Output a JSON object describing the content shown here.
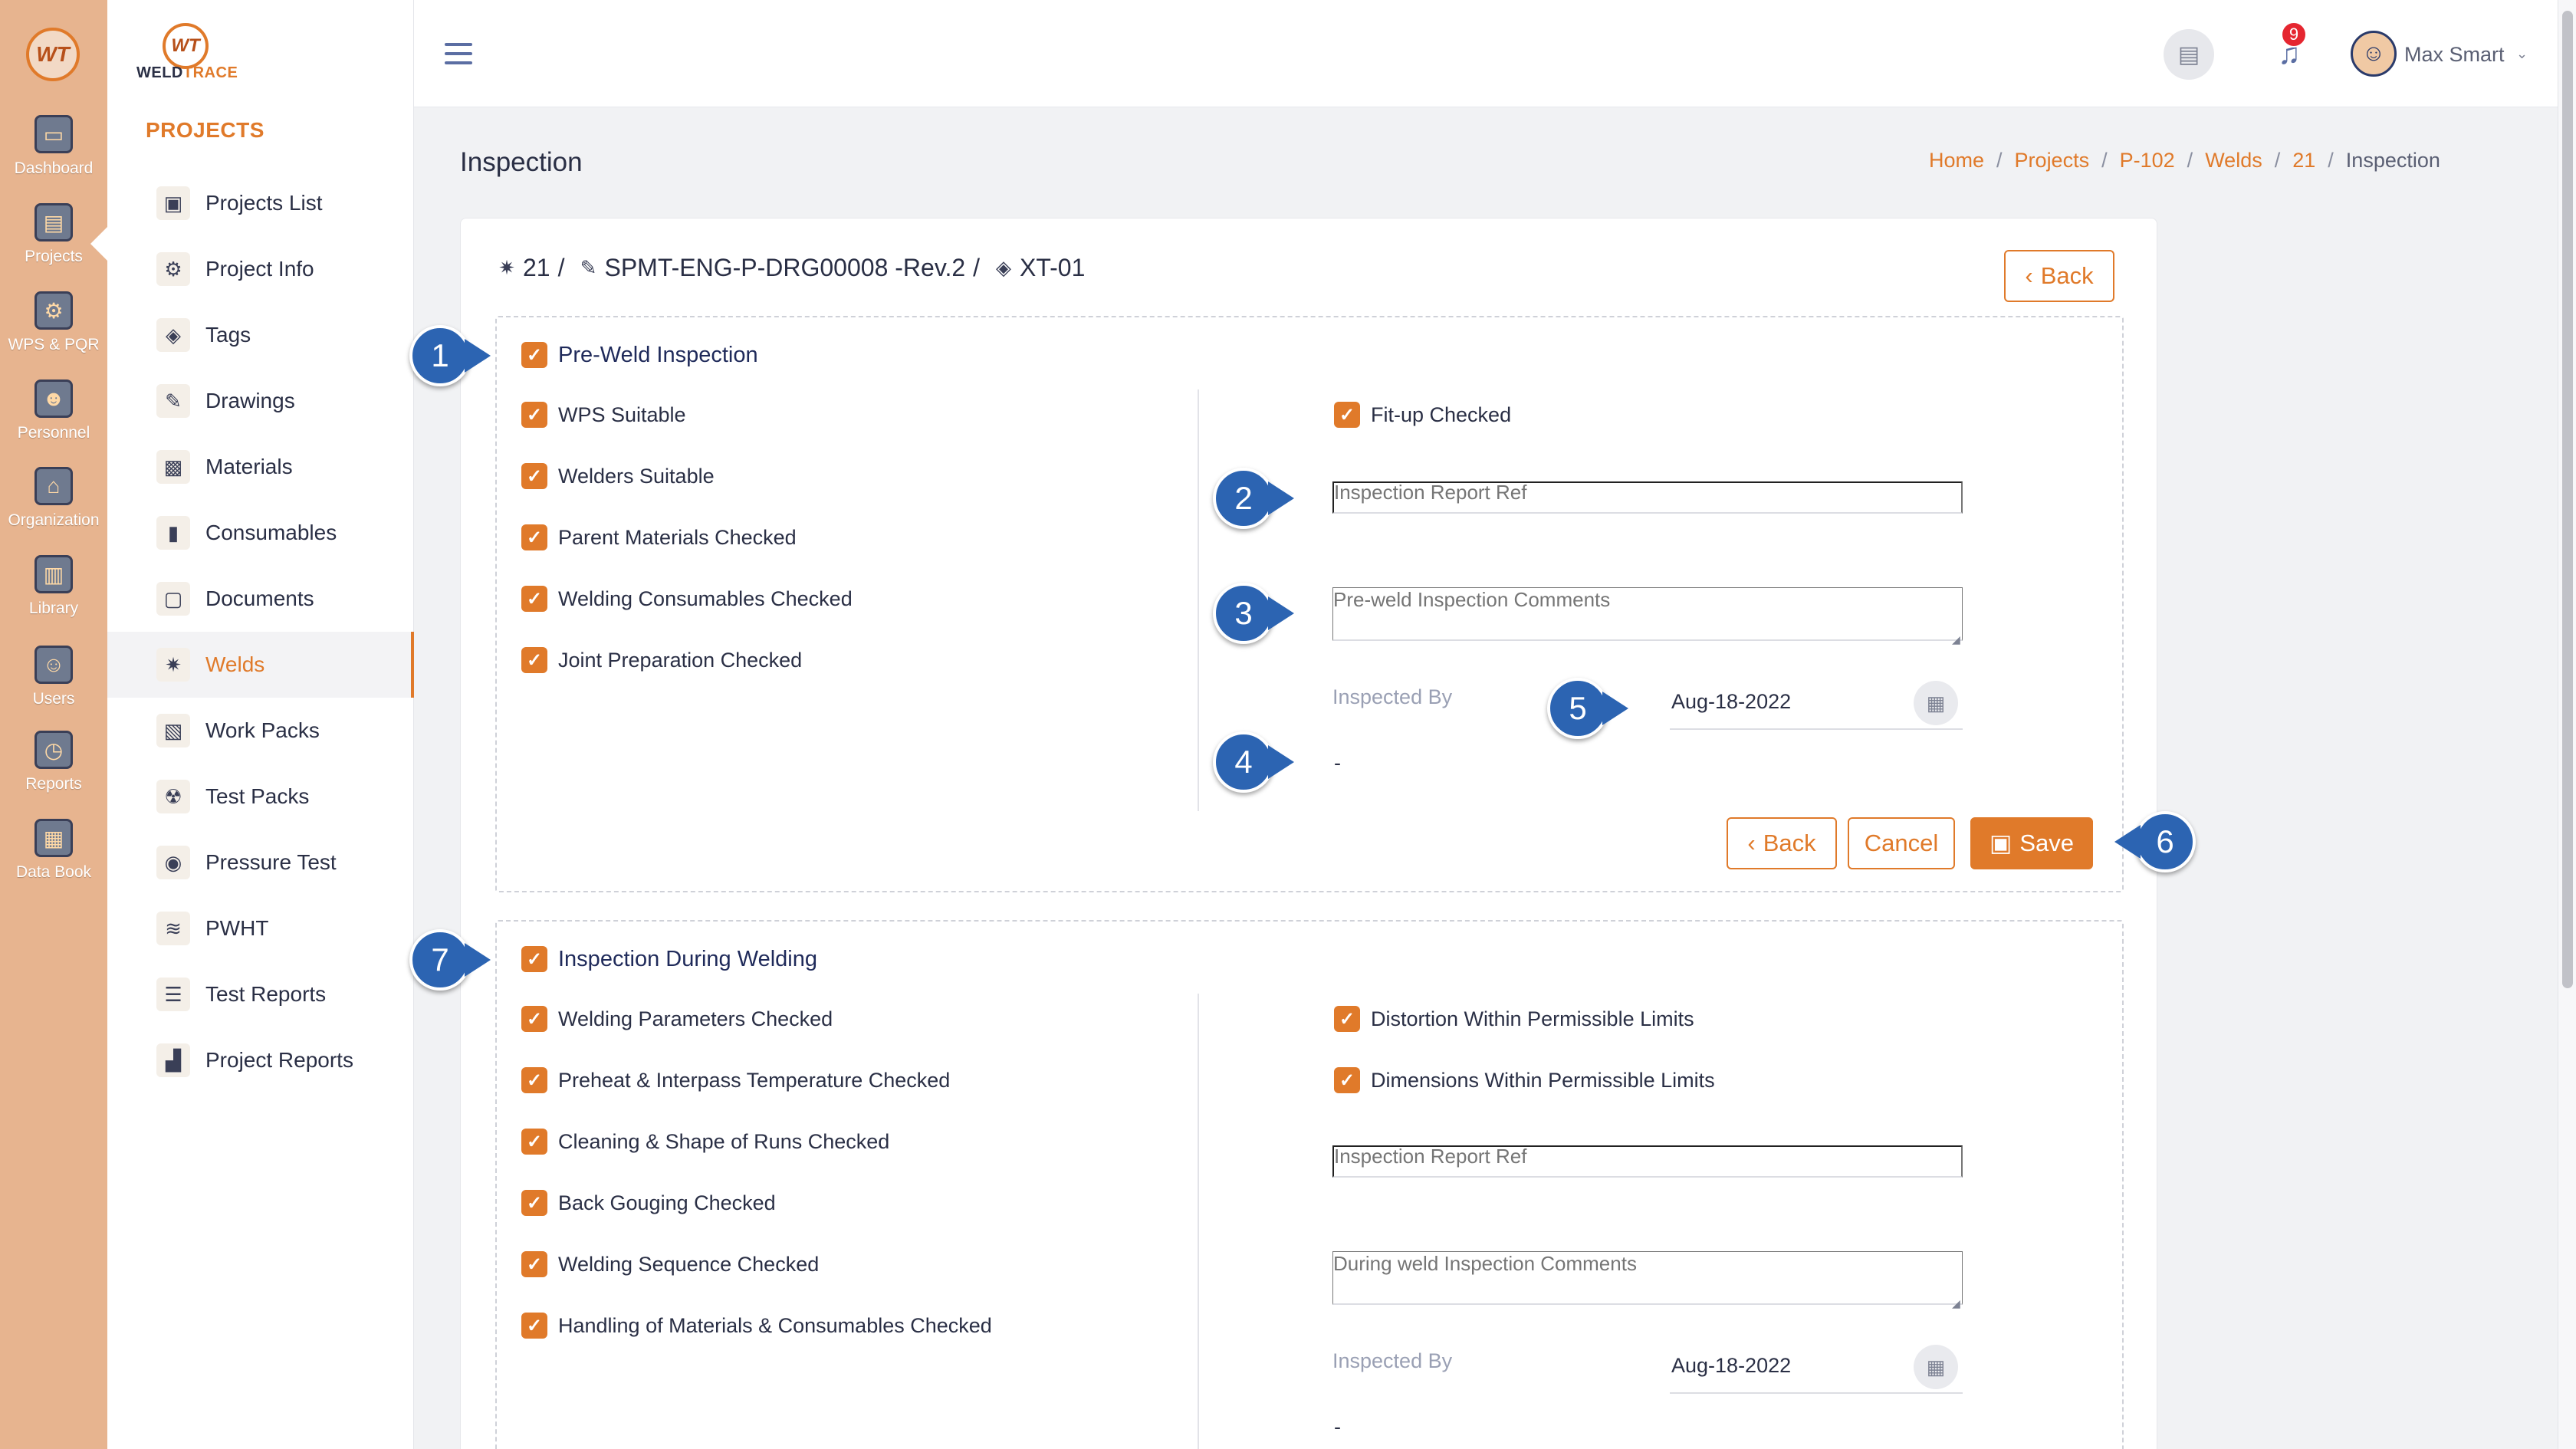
{
  "rail": {
    "logo": "WT",
    "items": [
      {
        "label": "Dashboard",
        "icon": "monitor-icon"
      },
      {
        "label": "Projects",
        "icon": "folder-gear-icon"
      },
      {
        "label": "WPS & PQR",
        "icon": "document-gear-icon"
      },
      {
        "label": "Personnel",
        "icon": "welder-icon"
      },
      {
        "label": "Organization",
        "icon": "organization-icon"
      },
      {
        "label": "Library",
        "icon": "book-icon"
      },
      {
        "label": "Users",
        "icon": "users-icon"
      },
      {
        "label": "Reports",
        "icon": "report-clock-icon"
      },
      {
        "label": "Data Book",
        "icon": "data-book-icon"
      }
    ]
  },
  "brand": {
    "mark": "WT",
    "name_prefix": "WELD",
    "name_suffix": "TRACE"
  },
  "sidebar": {
    "section_title": "PROJECTS",
    "items": [
      {
        "label": "Projects List",
        "icon": "projects-list-icon"
      },
      {
        "label": "Project Info",
        "icon": "project-info-icon"
      },
      {
        "label": "Tags",
        "icon": "tag-icon"
      },
      {
        "label": "Drawings",
        "icon": "drawing-icon"
      },
      {
        "label": "Materials",
        "icon": "materials-icon"
      },
      {
        "label": "Consumables",
        "icon": "consumables-icon"
      },
      {
        "label": "Documents",
        "icon": "documents-icon"
      },
      {
        "label": "Welds",
        "icon": "weld-spark-icon",
        "active": true
      },
      {
        "label": "Work Packs",
        "icon": "work-pack-icon"
      },
      {
        "label": "Test Packs",
        "icon": "radiation-icon"
      },
      {
        "label": "Pressure Test",
        "icon": "pressure-gauge-icon"
      },
      {
        "label": "PWHT",
        "icon": "heat-treatment-icon"
      },
      {
        "label": "Test Reports",
        "icon": "checklist-icon"
      },
      {
        "label": "Project Reports",
        "icon": "chart-report-icon"
      }
    ]
  },
  "header": {
    "notification_count": "9",
    "user_name": "Max Smart"
  },
  "page": {
    "title": "Inspection",
    "breadcrumb": [
      "Home",
      "Projects",
      "P-102",
      "Welds",
      "21",
      "Inspection"
    ]
  },
  "record": {
    "weld": "21",
    "drawing": "SPMT-ENG-P-DRG00008 -Rev.2",
    "tag": "XT-01"
  },
  "buttons": {
    "back": "Back",
    "cancel": "Cancel",
    "save": "Save"
  },
  "pre_weld": {
    "heading": "Pre-Weld Inspection",
    "left_checks": [
      "WPS Suitable",
      "Welders Suitable",
      "Parent Materials Checked",
      "Welding Consumables Checked",
      "Joint Preparation Checked"
    ],
    "right_checks": [
      "Fit-up Checked"
    ],
    "report_ref_placeholder": "Inspection Report Ref",
    "comments_placeholder": "Pre-weld Inspection Comments",
    "inspected_by_label": "Inspected By",
    "inspected_by_value": "-",
    "date": "Aug-18-2022"
  },
  "during_weld": {
    "heading": "Inspection During Welding",
    "left_checks": [
      "Welding Parameters Checked",
      "Preheat & Interpass Temperature Checked",
      "Cleaning & Shape of Runs Checked",
      "Back Gouging Checked",
      "Welding Sequence Checked",
      "Handling of Materials & Consumables Checked"
    ],
    "right_checks": [
      "Distortion Within Permissible Limits",
      "Dimensions Within Permissible Limits"
    ],
    "report_ref_placeholder": "Inspection Report Ref",
    "comments_placeholder": "During weld Inspection Comments",
    "inspected_by_label": "Inspected By",
    "inspected_by_value": "-",
    "date": "Aug-18-2022"
  },
  "callouts": [
    "1",
    "2",
    "3",
    "4",
    "5",
    "6",
    "7"
  ],
  "colors": {
    "accent": "#e07a2a",
    "rail": "#e7b48f",
    "callout": "#2c64b2",
    "badge": "#e52630"
  }
}
